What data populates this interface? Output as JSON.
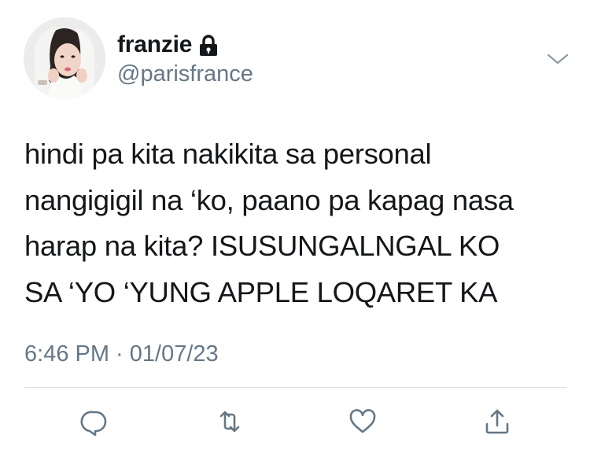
{
  "author": {
    "display_name": "franzie",
    "handle": "@parisfrance",
    "protected": true
  },
  "tweet": {
    "lines": [
      "hindi pa kita nakikita sa personal",
      "nangigigil na ‘ko, paano pa kapag nasa",
      "harap na kita? ISUSUNGALNGAL KO",
      "SA ‘YO ‘YUNG APPLE LOQARET KA"
    ],
    "timestamp": "6:46 PM · 01/07/23"
  },
  "icons": {
    "protected": "lock-icon",
    "menu": "chevron-down-icon",
    "reply": "reply-icon",
    "retweet": "retweet-icon",
    "like": "heart-icon",
    "share": "share-icon"
  },
  "colors": {
    "text": "#14171a",
    "secondary": "#657786",
    "divider": "#dcdcdc",
    "background": "#ffffff"
  }
}
